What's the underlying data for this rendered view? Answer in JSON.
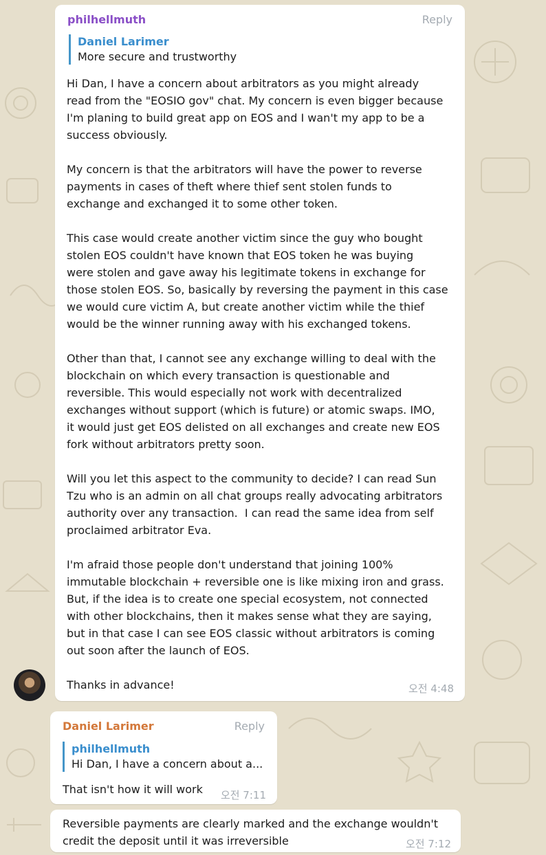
{
  "messages": [
    {
      "sender": "philhellmuth",
      "sender_color": "#8a4fc7",
      "reply_label": "Reply",
      "quote": {
        "name": "Daniel Larimer",
        "text": "More secure and trustworthy"
      },
      "text": "Hi Dan, I have a concern about arbitrators as you might already\nread from the \"EOSIO gov\" chat. My concern is even bigger because\nI'm planing to build great app on EOS and I wan't my app to be a\nsuccess obviously.\n\nMy concern is that the arbitrators will have the power to reverse\npayments in cases of theft where thief sent stolen funds to\nexchange and exchanged it to some other token.\n\nThis case would create another victim since the guy who bought\nstolen EOS couldn't have known that EOS token he was buying\nwere stolen and gave away his legitimate tokens in exchange for\nthose stolen EOS. So, basically by reversing the payment in this case\nwe would cure victim A, but create another victim while the thief\nwould be the winner running away with his exchanged tokens.\n\nOther than that, I cannot see any exchange willing to deal with the\nblockchain on which every transaction is questionable and\nreversible. This would especially not work with decentralized\nexchanges without support (which is future) or atomic swaps. IMO,\nit would just get EOS delisted on all exchanges and create new EOS\nfork without arbitrators pretty soon.\n\nWill you let this aspect to the community to decide? I can read Sun\nTzu who is an admin on all chat groups really advocating arbitrators\nauthority over any transaction.  I can read the same idea from self\nproclaimed arbitrator Eva.\n\nI'm afraid those people don't understand that joining 100%\nimmutable blockchain + reversible one is like mixing iron and grass.\nBut, if the idea is to create one special ecosystem, not connected\nwith other blockchains, then it makes sense what they are saying,\nbut in that case I can see EOS classic without arbitrators is coming\nout soon after the launch of EOS.\n\nThanks in advance!",
      "time": "오전 4:48"
    },
    {
      "sender": "Daniel Larimer",
      "sender_color": "#d3783a",
      "reply_label": "Reply",
      "quote": {
        "name": "philhellmuth",
        "text": "Hi Dan, I have a concern about a..."
      },
      "text": "That isn't how it will work",
      "time": "오전 7:11"
    },
    {
      "text": "Reversible payments are clearly marked and the exchange wouldn't\ncredit the deposit until it was irreversible",
      "time": "오전 7:12"
    }
  ],
  "icons": {
    "avatar": "user-avatar",
    "background": "chat-doodle-pattern"
  }
}
